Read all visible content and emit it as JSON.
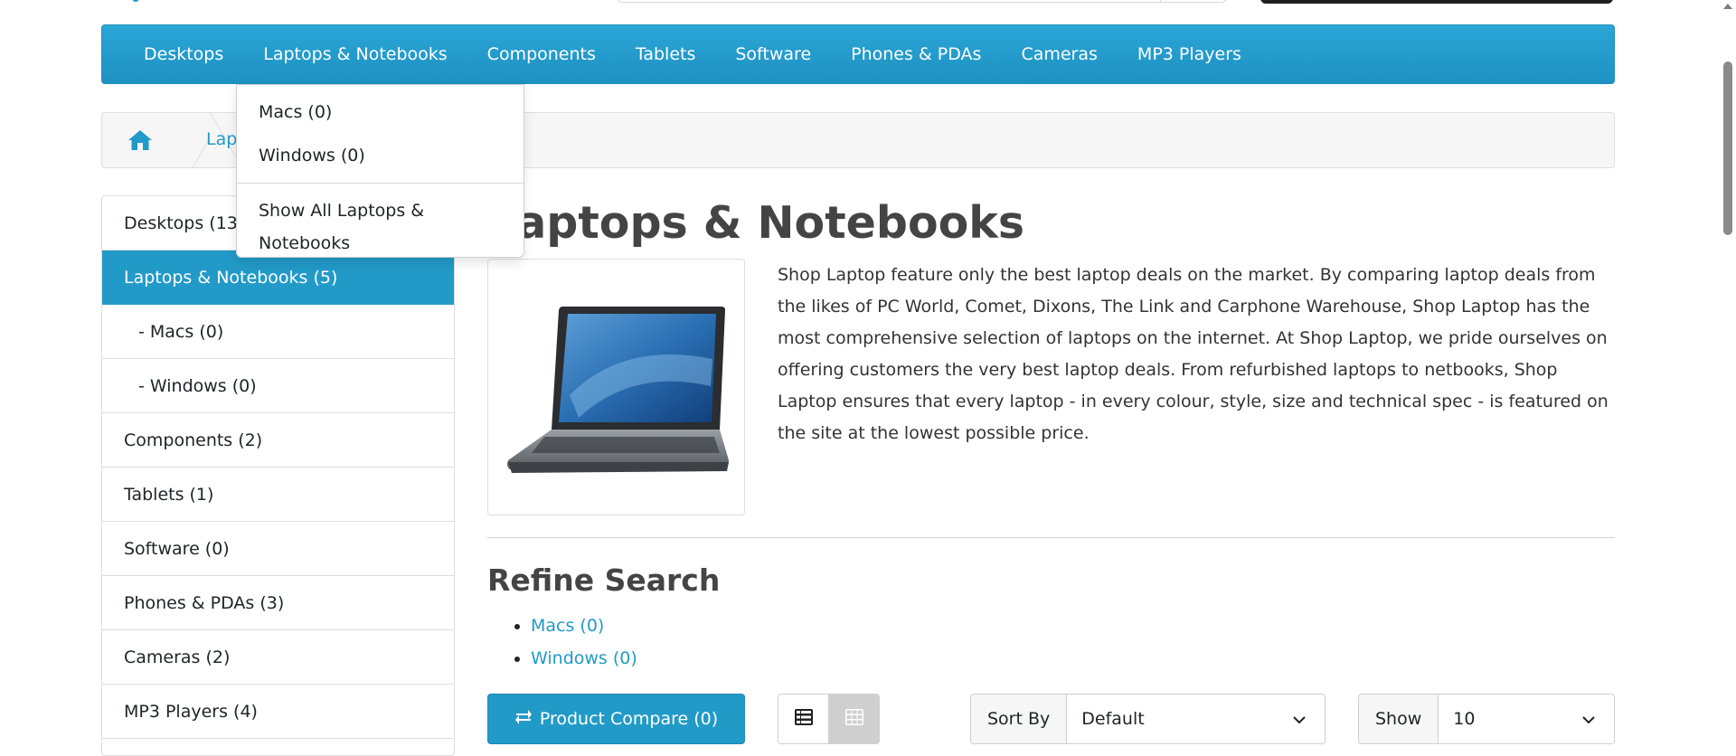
{
  "menu": {
    "items": [
      {
        "label": "Desktops"
      },
      {
        "label": "Laptops & Notebooks"
      },
      {
        "label": "Components"
      },
      {
        "label": "Tablets"
      },
      {
        "label": "Software"
      },
      {
        "label": "Phones & PDAs"
      },
      {
        "label": "Cameras"
      },
      {
        "label": "MP3 Players"
      }
    ]
  },
  "dropdown": {
    "items": [
      {
        "label": "Macs (0)"
      },
      {
        "label": "Windows (0)"
      }
    ],
    "show_all": "Show All Laptops & Notebooks"
  },
  "breadcrumb": {
    "home_icon": "home-icon",
    "current": "Laptops & Notebooks"
  },
  "sidebar": {
    "items": [
      {
        "label": "Desktops (13)"
      },
      {
        "label": "Laptops & Notebooks (5)"
      },
      {
        "label": "- Macs (0)"
      },
      {
        "label": "- Windows (0)"
      },
      {
        "label": "Components (2)"
      },
      {
        "label": "Tablets (1)"
      },
      {
        "label": "Software (0)"
      },
      {
        "label": "Phones & PDAs (3)"
      },
      {
        "label": "Cameras (2)"
      },
      {
        "label": "MP3 Players (4)"
      }
    ]
  },
  "category": {
    "title": "Laptops & Notebooks",
    "description": "Shop Laptop feature only the best laptop deals on the market. By comparing laptop deals from the likes of PC World, Comet, Dixons, The Link and Carphone Warehouse, Shop Laptop has the most comprehensive selection of laptops on the internet. At Shop Laptop, we pride ourselves on offering customers the very best laptop deals. From refurbished laptops to netbooks, Shop Laptop ensures that every laptop - in every colour, style, size and technical spec - is featured on the site at the lowest possible price."
  },
  "refine": {
    "title": "Refine Search",
    "items": [
      {
        "label": "Macs (0)"
      },
      {
        "label": "Windows (0)"
      }
    ]
  },
  "toolbar": {
    "compare_label": "Product Compare (0)",
    "sort_label": "Sort By",
    "sort_value": "Default",
    "show_label": "Show",
    "show_value": "10"
  },
  "colors": {
    "accent": "#229ac8",
    "active_bg": "#229ac8"
  }
}
